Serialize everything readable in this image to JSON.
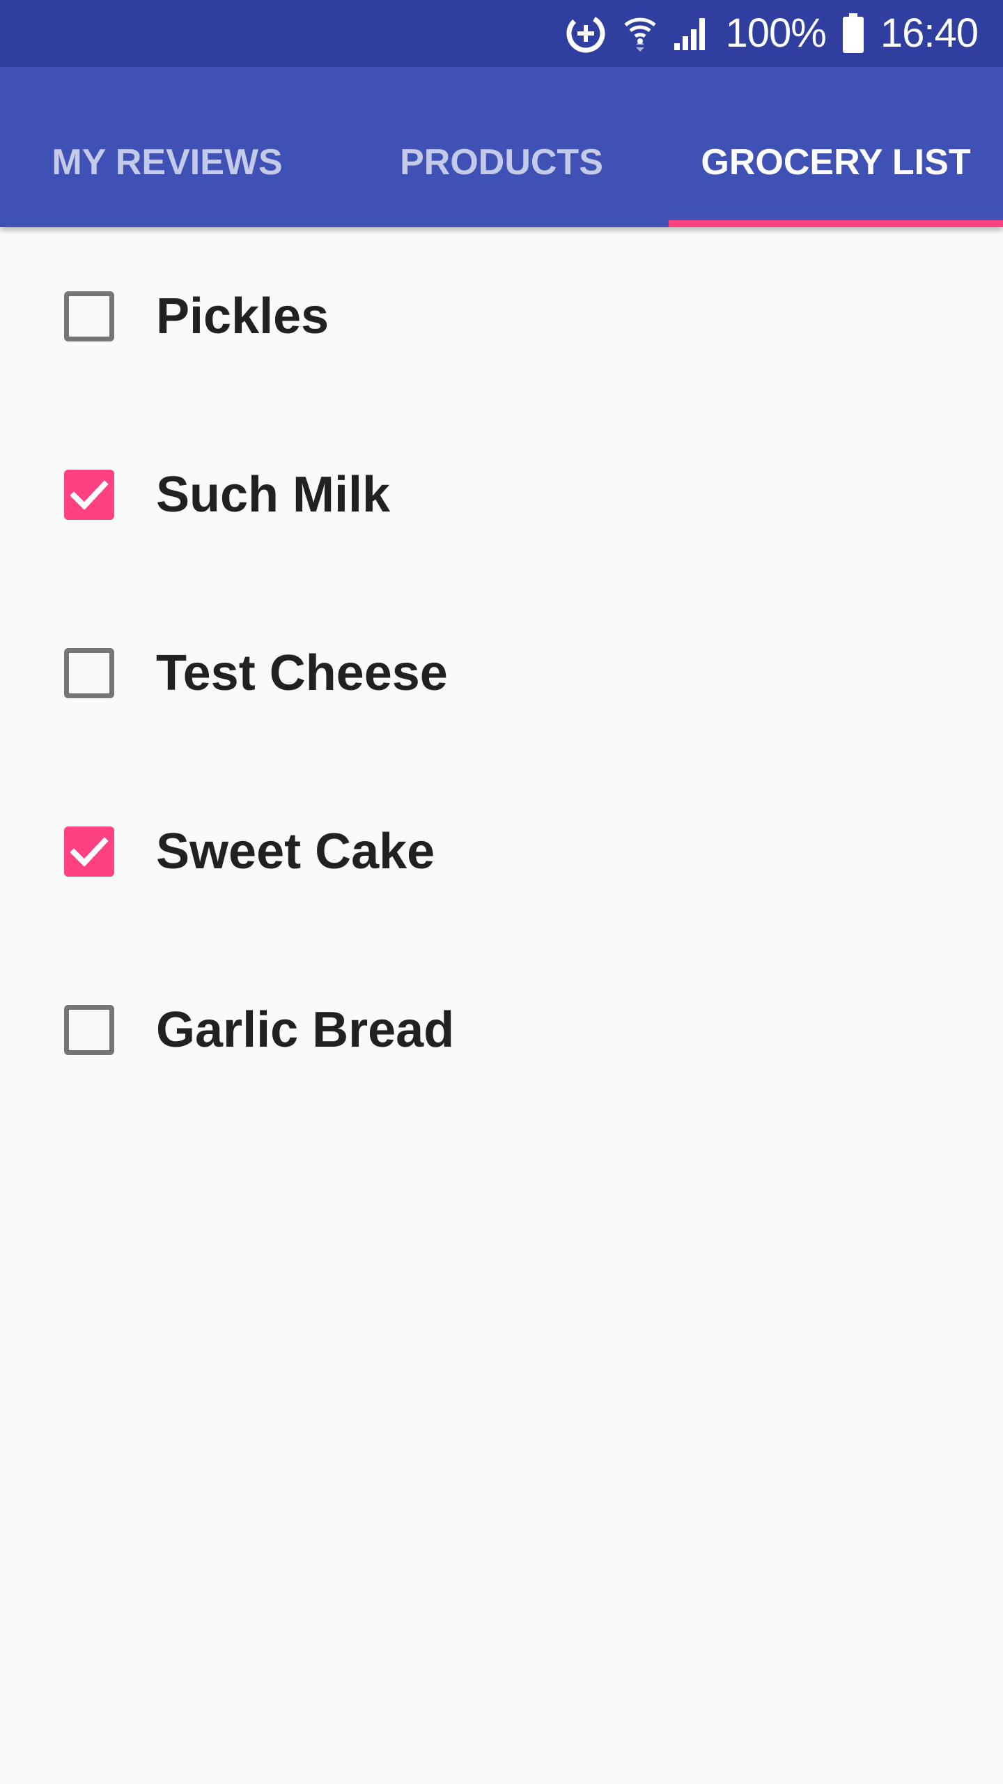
{
  "status_bar": {
    "battery_percent": "100%",
    "time": "16:40",
    "icons": [
      "data-saver-icon",
      "wifi-icon",
      "signal-icon",
      "battery-icon"
    ]
  },
  "tabs": [
    {
      "label": "MY REVIEWS",
      "active": false
    },
    {
      "label": "PRODUCTS",
      "active": false
    },
    {
      "label": "GROCERY LIST",
      "active": true
    }
  ],
  "grocery_list": {
    "items": [
      {
        "label": "Pickles",
        "checked": false
      },
      {
        "label": "Such Milk",
        "checked": true
      },
      {
        "label": "Test Cheese",
        "checked": false
      },
      {
        "label": "Sweet Cake",
        "checked": true
      },
      {
        "label": "Garlic Bread",
        "checked": false
      }
    ]
  },
  "colors": {
    "status_bar": "#303f9f",
    "app_bar": "#3f51b5",
    "accent": "#ff4081",
    "background": "#fafafa",
    "text": "#212121"
  }
}
